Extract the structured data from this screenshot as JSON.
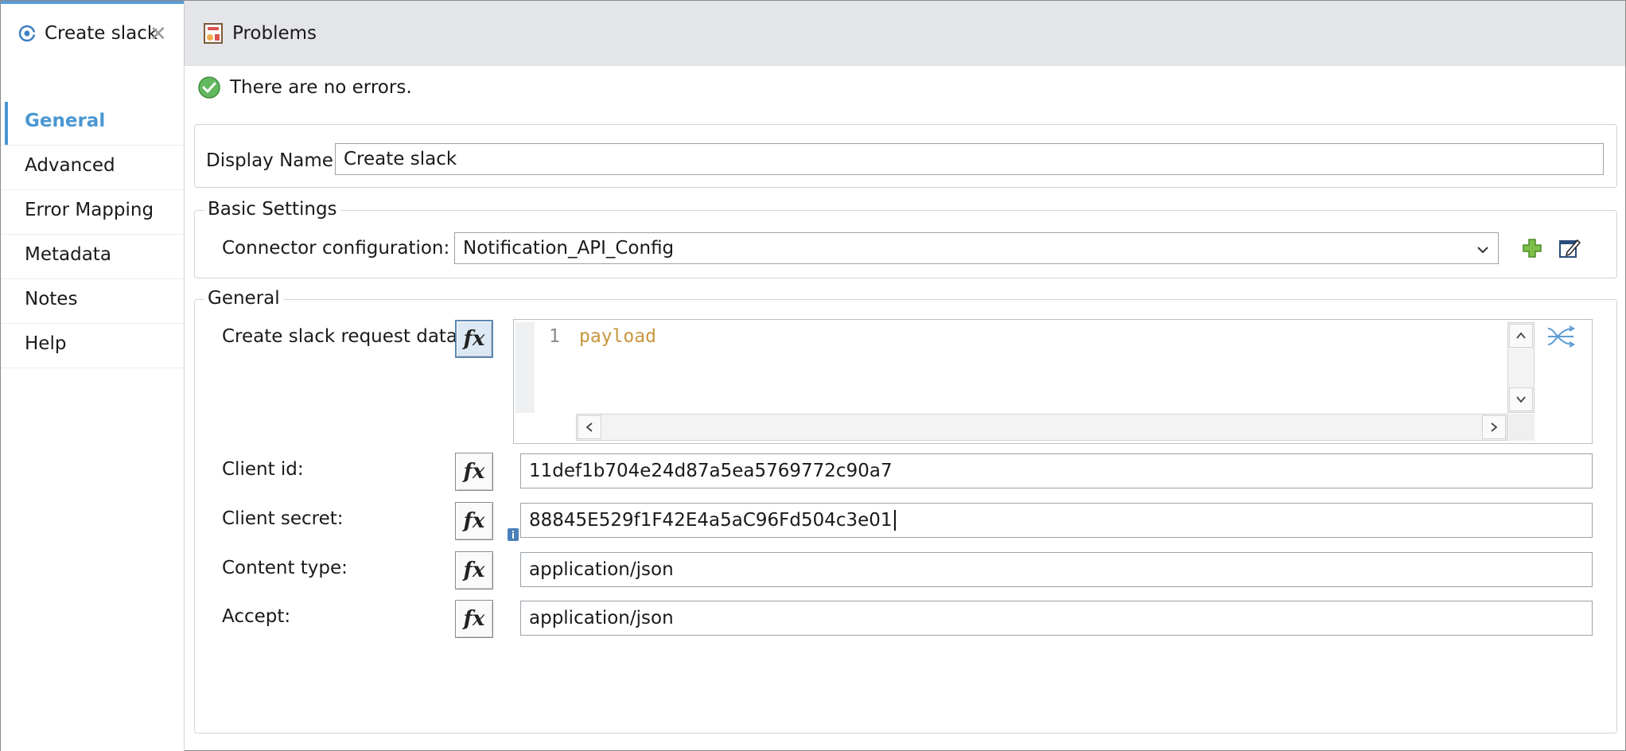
{
  "tabs": [
    {
      "label": "Create slack",
      "icon": "connector-icon",
      "active": true
    },
    {
      "label": "Problems",
      "icon": "problems-icon",
      "active": false
    }
  ],
  "status": {
    "text": "There are no errors.",
    "icon": "check-circle-icon"
  },
  "sidebar": {
    "items": [
      {
        "label": "General",
        "active": true
      },
      {
        "label": "Advanced"
      },
      {
        "label": "Error Mapping"
      },
      {
        "label": "Metadata"
      },
      {
        "label": "Notes"
      },
      {
        "label": "Help"
      }
    ]
  },
  "display_name": {
    "label": "Display Name:",
    "value": "Create slack"
  },
  "basic_settings": {
    "title": "Basic Settings",
    "connector_label": "Connector configuration:",
    "connector_value": "Notification_API_Config"
  },
  "general": {
    "title": "General",
    "request_label": "Create slack request data:",
    "editor": {
      "line_number": "1",
      "code": "payload"
    },
    "fields": [
      {
        "label": "Client id:",
        "value": "11def1b704e24d87a5ea5769772c90a7"
      },
      {
        "label": "Client secret:",
        "value": "88845E529f1F42E4a5aC96Fd504c3e01"
      },
      {
        "label": "Content type:",
        "value": "application/json"
      },
      {
        "label": "Accept:",
        "value": "application/json"
      }
    ]
  },
  "fx_label": "fx",
  "colors": {
    "accent": "#4a97d2",
    "code": "#c8963e",
    "success": "#5cb85c",
    "tabbar": "#e3e5e8"
  }
}
